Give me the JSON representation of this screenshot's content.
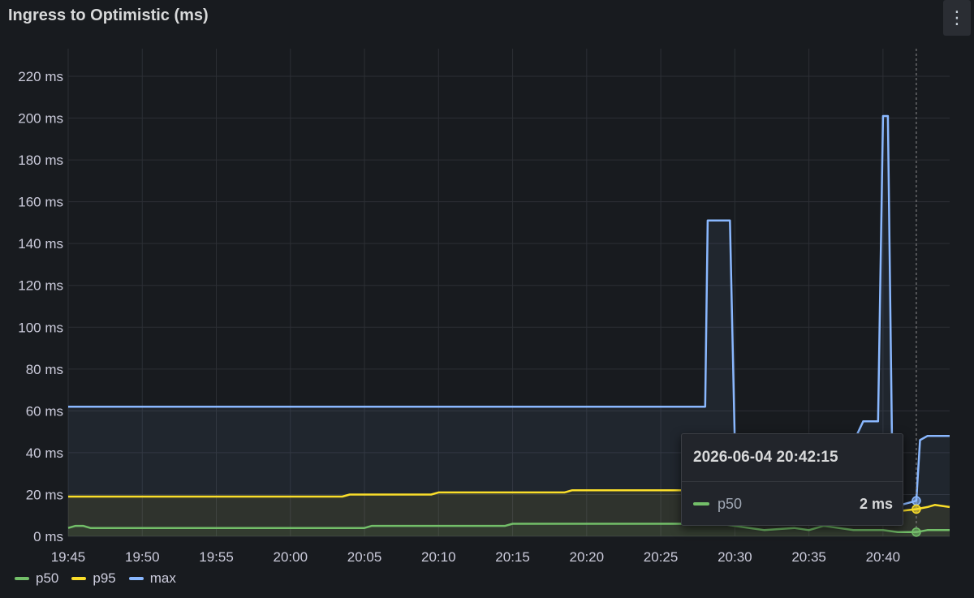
{
  "panel": {
    "title": "Ingress to Optimistic (ms)",
    "menu_glyph": "⋮"
  },
  "colors": {
    "background": "#181b1f",
    "grid": "#2c2f35",
    "p50": "#73bf69",
    "p95": "#fade2a",
    "max": "#8ab8ff"
  },
  "chart_data": {
    "type": "line",
    "ylim": [
      0,
      230
    ],
    "y_ticks": [
      0,
      20,
      40,
      60,
      80,
      100,
      120,
      140,
      160,
      180,
      200,
      220
    ],
    "y_tick_labels": [
      "0 ms",
      "20 ms",
      "40 ms",
      "60 ms",
      "80 ms",
      "100 ms",
      "120 ms",
      "140 ms",
      "160 ms",
      "180 ms",
      "200 ms",
      "220 ms"
    ],
    "x_range": [
      "19:45",
      "20:44:30"
    ],
    "x_ticks": [
      "19:45",
      "19:50",
      "19:55",
      "20:00",
      "20:05",
      "20:10",
      "20:15",
      "20:20",
      "20:25",
      "20:30",
      "20:35",
      "20:40"
    ],
    "series": [
      {
        "name": "max",
        "color": "#8ab8ff",
        "points": [
          [
            "19:45",
            62
          ],
          [
            "20:28",
            62
          ],
          [
            "20:28:10",
            151
          ],
          [
            "20:29:40",
            151
          ],
          [
            "20:30",
            45
          ],
          [
            "20:38",
            45
          ],
          [
            "20:38:40",
            55
          ],
          [
            "20:39:40",
            55
          ],
          [
            "20:40",
            201
          ],
          [
            "20:40:20",
            201
          ],
          [
            "20:40:40",
            14
          ],
          [
            "20:42:15",
            17
          ],
          [
            "20:42:30",
            46
          ],
          [
            "20:43",
            48
          ],
          [
            "20:44:30",
            48
          ]
        ]
      },
      {
        "name": "p95",
        "color": "#fade2a",
        "points": [
          [
            "19:45",
            19
          ],
          [
            "20:03:30",
            19
          ],
          [
            "20:04",
            20
          ],
          [
            "20:09:30",
            20
          ],
          [
            "20:10",
            21
          ],
          [
            "20:18:30",
            21
          ],
          [
            "20:19",
            22
          ],
          [
            "20:30",
            22
          ],
          [
            "20:35",
            16
          ],
          [
            "20:40",
            15
          ],
          [
            "20:41",
            12
          ],
          [
            "20:42:15",
            13
          ],
          [
            "20:43",
            14
          ],
          [
            "20:43:30",
            15
          ],
          [
            "20:44:30",
            14
          ]
        ]
      },
      {
        "name": "p50",
        "color": "#73bf69",
        "points": [
          [
            "19:45",
            4
          ],
          [
            "19:45:30",
            5
          ],
          [
            "19:46",
            5
          ],
          [
            "19:46:30",
            4
          ],
          [
            "20:05",
            4
          ],
          [
            "20:05:30",
            5
          ],
          [
            "20:14:30",
            5
          ],
          [
            "20:15",
            6
          ],
          [
            "20:29",
            6
          ],
          [
            "20:30",
            5
          ],
          [
            "20:31",
            4
          ],
          [
            "20:32",
            3
          ],
          [
            "20:34",
            4
          ],
          [
            "20:35",
            3
          ],
          [
            "20:36",
            5
          ],
          [
            "20:37",
            4
          ],
          [
            "20:38",
            3
          ],
          [
            "20:40",
            3
          ],
          [
            "20:41",
            2
          ],
          [
            "20:42:15",
            2
          ],
          [
            "20:43",
            3
          ],
          [
            "20:44:30",
            3
          ]
        ]
      }
    ],
    "hover_time": "20:42:15",
    "grid": true,
    "legend_position": "bottom-left"
  },
  "tooltip": {
    "time": "2026-06-04 20:42:15",
    "series_name": "p50",
    "value": "2 ms"
  },
  "legend": [
    {
      "name": "p50",
      "color": "#73bf69"
    },
    {
      "name": "p95",
      "color": "#fade2a"
    },
    {
      "name": "max",
      "color": "#8ab8ff"
    }
  ]
}
